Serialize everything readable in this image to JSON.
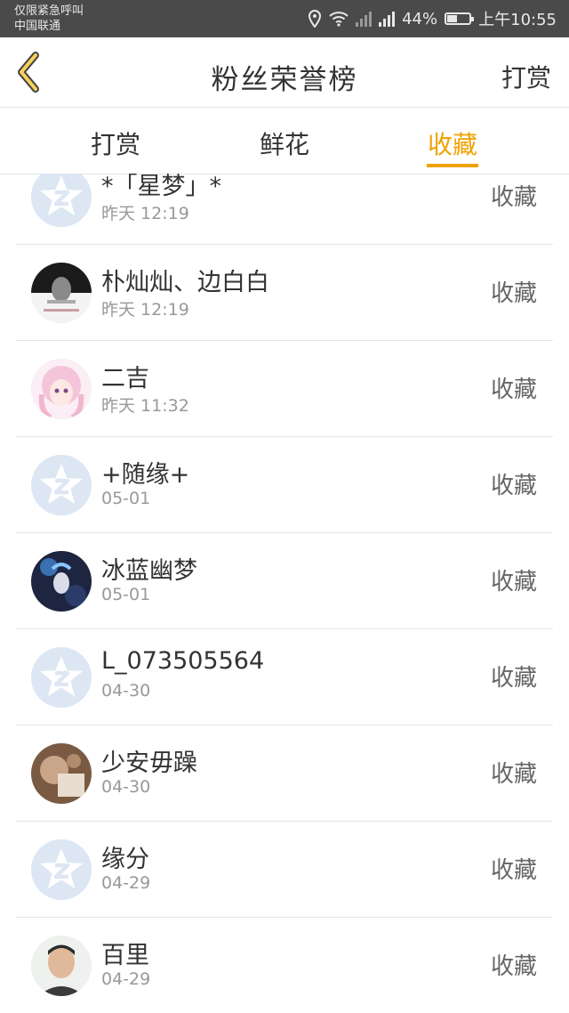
{
  "status_bar": {
    "line1": "仅限紧急呼叫",
    "line2": "中国联通",
    "battery": "44%",
    "battery_level": 0.44,
    "time": "上午10:55"
  },
  "header": {
    "title": "粉丝荣誉榜",
    "action": "打赏"
  },
  "tabs": [
    {
      "label": "打赏"
    },
    {
      "label": "鲜花"
    },
    {
      "label": "收藏"
    }
  ],
  "active_tab": 2,
  "accent_color": "#f0a100",
  "rows": [
    {
      "name": "*「星梦」*",
      "time": "昨天 12:19",
      "action": "收藏",
      "avatar": "default-qq-icon"
    },
    {
      "name": "朴灿灿、边白白",
      "time": "昨天 12:19",
      "action": "收藏",
      "avatar": "photo"
    },
    {
      "name": "二吉",
      "time": "昨天 11:32",
      "action": "收藏",
      "avatar": "anime-girl"
    },
    {
      "name": "+随缘+",
      "time": "05-01",
      "action": "收藏",
      "avatar": "default-qq-icon"
    },
    {
      "name": "冰蓝幽梦",
      "time": "05-01",
      "action": "收藏",
      "avatar": "anime-dark"
    },
    {
      "name": "L_073505564",
      "time": "04-30",
      "action": "收藏",
      "avatar": "default-qq-icon"
    },
    {
      "name": "少安毋躁",
      "time": "04-30",
      "action": "收藏",
      "avatar": "photo-warm"
    },
    {
      "name": "缘分",
      "time": "04-29",
      "action": "收藏",
      "avatar": "default-qq-icon"
    },
    {
      "name": "百里",
      "time": "04-29",
      "action": "收藏",
      "avatar": "photo-person"
    }
  ]
}
